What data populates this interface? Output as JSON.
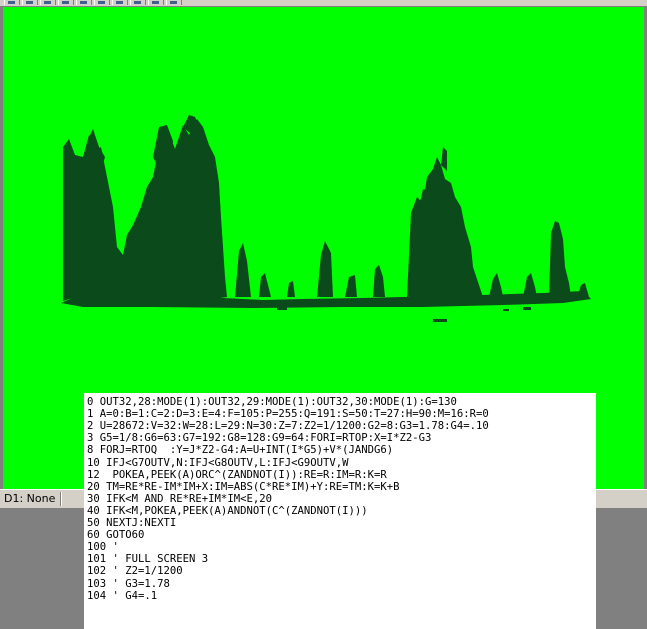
{
  "toolbar": {
    "buttons": [
      "new-icon",
      "open-icon",
      "save-icon",
      "cut-icon",
      "copy-icon",
      "paste-icon",
      "undo-icon",
      "run-icon",
      "stop-icon",
      "help-icon"
    ]
  },
  "statusbar": {
    "text": "D1: None"
  },
  "listing": {
    "lines": [
      "0 OUT32,28:MODE(1):OUT32,29:MODE(1):OUT32,30:MODE(1):G=130",
      "1 A=0:B=1:C=2:D=3:E=4:F=105:P=255:Q=191:S=50:T=27:H=90:M=16:R=0",
      "2 U=28672:V=32:W=28:L=29:N=30:Z=7:Z2=1/1200:G2=8:G3=1.78:G4=.10",
      "3 G5=1/8:G6=63:G7=192:G8=128:G9=64:FORI=RTOP:X=I*Z2-G3",
      "8 FORJ=RTOQ  :Y=J*Z2-G4:A=U+INT(I*G5)+V*(JANDG6)",
      "10 IFJ<G7OUTV,N:IFJ<G8OUTV,L:IFJ<G9OUTV,W",
      "12  POKEA,PEEK(A)ORC^(ZANDNOT(I)):RE=R:IM=R:K=R",
      "20 TM=RE*RE-IM*IM+X:IM=ABS(C*RE*IM)+Y:RE=TM:K=K+B",
      "30 IFK<M AND RE*RE+IM*IM<E,20",
      "40 IFK<M,POKEA,PEEK(A)ANDNOT(C^(ZANDNOT(I)))",
      "50 NEXTJ:NEXTI",
      "60 GOTO60",
      "100 '",
      "101 ' FULL SCREEN 3",
      "102 ' Z2=1/1200",
      "103 ' G3=1.78",
      "104 ' G4=.1"
    ]
  },
  "colors": {
    "screen_background": "#00ff00",
    "fractal": "#0b4a1a",
    "window_chrome": "#d4d0c8",
    "desktop": "#808080"
  }
}
